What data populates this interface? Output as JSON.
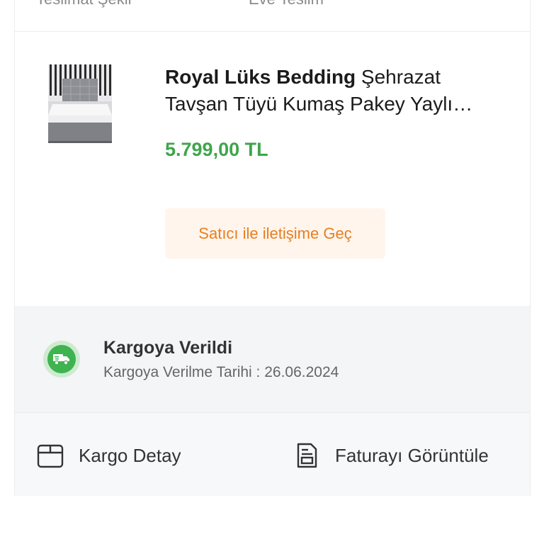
{
  "delivery_row": {
    "label": "Teslimat Şekli",
    "value": "Eve Teslim"
  },
  "product": {
    "brand": "Royal Lüks Bedding",
    "name_line1": " Şehrazat",
    "name_line2": "Tavşan Tüyü Kumaş Pakey Yaylı…",
    "price": "5.799,00 TL",
    "image_icon": "mattress-product-image"
  },
  "contact_button": {
    "label": "Satıcı ile iletişime Geç"
  },
  "shipment": {
    "icon": "delivery-truck-icon",
    "status": "Kargoya Verildi",
    "date_text": "Kargoya Verilme Tarihi : 26.06.2024"
  },
  "actions": {
    "cargo_icon": "box-icon",
    "cargo_label": "Kargo Detay",
    "invoice_icon": "invoice-icon",
    "invoice_label": "Faturayı Görüntüle"
  },
  "colors": {
    "price": "#3fa54b",
    "contact_text": "#e87e1e",
    "contact_bg": "#fff5ed",
    "status_icon": "#3fb34f"
  }
}
